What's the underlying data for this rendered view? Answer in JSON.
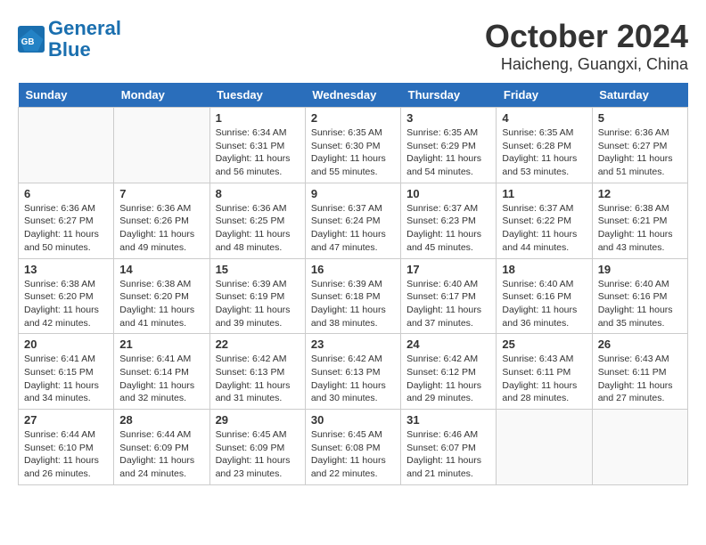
{
  "logo": {
    "line1": "General",
    "line2": "Blue"
  },
  "title": "October 2024",
  "location": "Haicheng, Guangxi, China",
  "headers": [
    "Sunday",
    "Monday",
    "Tuesday",
    "Wednesday",
    "Thursday",
    "Friday",
    "Saturday"
  ],
  "weeks": [
    [
      {
        "day": "",
        "content": ""
      },
      {
        "day": "",
        "content": ""
      },
      {
        "day": "1",
        "content": "Sunrise: 6:34 AM\nSunset: 6:31 PM\nDaylight: 11 hours\nand 56 minutes."
      },
      {
        "day": "2",
        "content": "Sunrise: 6:35 AM\nSunset: 6:30 PM\nDaylight: 11 hours\nand 55 minutes."
      },
      {
        "day": "3",
        "content": "Sunrise: 6:35 AM\nSunset: 6:29 PM\nDaylight: 11 hours\nand 54 minutes."
      },
      {
        "day": "4",
        "content": "Sunrise: 6:35 AM\nSunset: 6:28 PM\nDaylight: 11 hours\nand 53 minutes."
      },
      {
        "day": "5",
        "content": "Sunrise: 6:36 AM\nSunset: 6:27 PM\nDaylight: 11 hours\nand 51 minutes."
      }
    ],
    [
      {
        "day": "6",
        "content": "Sunrise: 6:36 AM\nSunset: 6:27 PM\nDaylight: 11 hours\nand 50 minutes."
      },
      {
        "day": "7",
        "content": "Sunrise: 6:36 AM\nSunset: 6:26 PM\nDaylight: 11 hours\nand 49 minutes."
      },
      {
        "day": "8",
        "content": "Sunrise: 6:36 AM\nSunset: 6:25 PM\nDaylight: 11 hours\nand 48 minutes."
      },
      {
        "day": "9",
        "content": "Sunrise: 6:37 AM\nSunset: 6:24 PM\nDaylight: 11 hours\nand 47 minutes."
      },
      {
        "day": "10",
        "content": "Sunrise: 6:37 AM\nSunset: 6:23 PM\nDaylight: 11 hours\nand 45 minutes."
      },
      {
        "day": "11",
        "content": "Sunrise: 6:37 AM\nSunset: 6:22 PM\nDaylight: 11 hours\nand 44 minutes."
      },
      {
        "day": "12",
        "content": "Sunrise: 6:38 AM\nSunset: 6:21 PM\nDaylight: 11 hours\nand 43 minutes."
      }
    ],
    [
      {
        "day": "13",
        "content": "Sunrise: 6:38 AM\nSunset: 6:20 PM\nDaylight: 11 hours\nand 42 minutes."
      },
      {
        "day": "14",
        "content": "Sunrise: 6:38 AM\nSunset: 6:20 PM\nDaylight: 11 hours\nand 41 minutes."
      },
      {
        "day": "15",
        "content": "Sunrise: 6:39 AM\nSunset: 6:19 PM\nDaylight: 11 hours\nand 39 minutes."
      },
      {
        "day": "16",
        "content": "Sunrise: 6:39 AM\nSunset: 6:18 PM\nDaylight: 11 hours\nand 38 minutes."
      },
      {
        "day": "17",
        "content": "Sunrise: 6:40 AM\nSunset: 6:17 PM\nDaylight: 11 hours\nand 37 minutes."
      },
      {
        "day": "18",
        "content": "Sunrise: 6:40 AM\nSunset: 6:16 PM\nDaylight: 11 hours\nand 36 minutes."
      },
      {
        "day": "19",
        "content": "Sunrise: 6:40 AM\nSunset: 6:16 PM\nDaylight: 11 hours\nand 35 minutes."
      }
    ],
    [
      {
        "day": "20",
        "content": "Sunrise: 6:41 AM\nSunset: 6:15 PM\nDaylight: 11 hours\nand 34 minutes."
      },
      {
        "day": "21",
        "content": "Sunrise: 6:41 AM\nSunset: 6:14 PM\nDaylight: 11 hours\nand 32 minutes."
      },
      {
        "day": "22",
        "content": "Sunrise: 6:42 AM\nSunset: 6:13 PM\nDaylight: 11 hours\nand 31 minutes."
      },
      {
        "day": "23",
        "content": "Sunrise: 6:42 AM\nSunset: 6:13 PM\nDaylight: 11 hours\nand 30 minutes."
      },
      {
        "day": "24",
        "content": "Sunrise: 6:42 AM\nSunset: 6:12 PM\nDaylight: 11 hours\nand 29 minutes."
      },
      {
        "day": "25",
        "content": "Sunrise: 6:43 AM\nSunset: 6:11 PM\nDaylight: 11 hours\nand 28 minutes."
      },
      {
        "day": "26",
        "content": "Sunrise: 6:43 AM\nSunset: 6:11 PM\nDaylight: 11 hours\nand 27 minutes."
      }
    ],
    [
      {
        "day": "27",
        "content": "Sunrise: 6:44 AM\nSunset: 6:10 PM\nDaylight: 11 hours\nand 26 minutes."
      },
      {
        "day": "28",
        "content": "Sunrise: 6:44 AM\nSunset: 6:09 PM\nDaylight: 11 hours\nand 24 minutes."
      },
      {
        "day": "29",
        "content": "Sunrise: 6:45 AM\nSunset: 6:09 PM\nDaylight: 11 hours\nand 23 minutes."
      },
      {
        "day": "30",
        "content": "Sunrise: 6:45 AM\nSunset: 6:08 PM\nDaylight: 11 hours\nand 22 minutes."
      },
      {
        "day": "31",
        "content": "Sunrise: 6:46 AM\nSunset: 6:07 PM\nDaylight: 11 hours\nand 21 minutes."
      },
      {
        "day": "",
        "content": ""
      },
      {
        "day": "",
        "content": ""
      }
    ]
  ]
}
